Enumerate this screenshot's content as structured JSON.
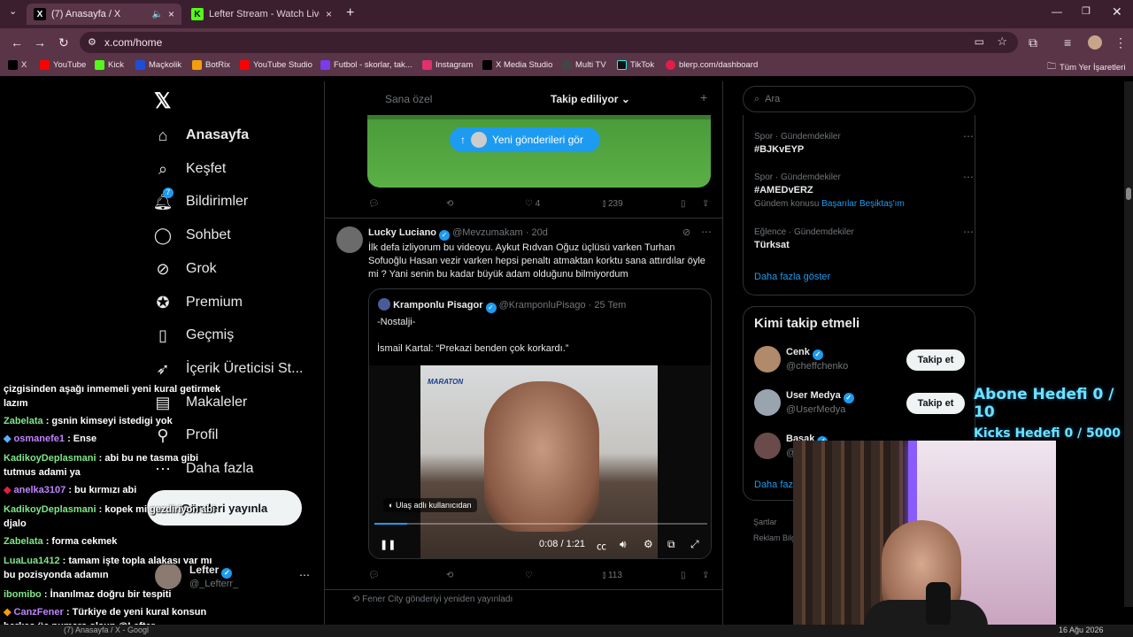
{
  "browser": {
    "tabs": [
      {
        "label": "(7) Anasayfa / X",
        "favicon": "x-icon",
        "active": true
      },
      {
        "label": "Lefter Stream - Watch Live on K",
        "favicon": "kick-icon",
        "active": false
      }
    ],
    "url": "x.com/home",
    "bookmarks": [
      {
        "label": "X",
        "color": "#000000"
      },
      {
        "label": "YouTube",
        "color": "#ff0000"
      },
      {
        "label": "Kick",
        "color": "#53fc18"
      },
      {
        "label": "Maçkolik",
        "color": "#1d4ed8"
      },
      {
        "label": "BotRix",
        "color": "#f59e0b"
      },
      {
        "label": "YouTube Studio",
        "color": "#ff0000"
      },
      {
        "label": "Futbol - skorlar, tak...",
        "color": "#7c3aed"
      },
      {
        "label": "Instagram",
        "color": "#e1306c"
      },
      {
        "label": "X Media Studio",
        "color": "#000000"
      },
      {
        "label": "Multi TV",
        "color": "#444444"
      },
      {
        "label": "TikTok",
        "color": "#111111"
      },
      {
        "label": "blerp.com/dashboard",
        "color": "#e11d48"
      }
    ],
    "all_bookmarks": "Tüm Yer İşaretleri"
  },
  "sidebar": {
    "items": [
      {
        "label": "Anasayfa",
        "icon": "home-icon"
      },
      {
        "label": "Keşfet",
        "icon": "search-icon"
      },
      {
        "label": "Bildirimler",
        "icon": "bell-icon",
        "badge": "7"
      },
      {
        "label": "Sohbet",
        "icon": "chat-icon"
      },
      {
        "label": "Grok",
        "icon": "grok-icon"
      },
      {
        "label": "Premium",
        "icon": "premium-icon"
      },
      {
        "label": "Geçmiş",
        "icon": "bookmark-icon"
      },
      {
        "label": "İçerik Üreticisi St...",
        "icon": "rocket-icon"
      },
      {
        "label": "Makaleler",
        "icon": "article-icon"
      },
      {
        "label": "Profil",
        "icon": "profile-icon"
      },
      {
        "label": "Daha fazla",
        "icon": "more-icon"
      }
    ],
    "post_button": "Gönderi yayınla",
    "account": {
      "name": "Lefter",
      "handle": "@_Leftеrr_"
    }
  },
  "feed": {
    "tabs": [
      "Sana özel",
      "Takip ediliyor"
    ],
    "new_posts_pill": "Yeni gönderileri gör",
    "post1_actions": {
      "likes": "4",
      "views": "239"
    },
    "post2": {
      "name": "Lucky Luciano",
      "handle": "@Mevzumakam",
      "time": "· 20d",
      "text": "İlk defa izliyorum bu videoyu. Aykut Rıdvan Oğuz üçlüsü varken Turhan Sofuoğlu Hasan vezir varken hepsi penaltı atmaktan korktu sana attırdılar öyle mi ? Yani senin bu kadar büyük adam olduğunu bilmiyordum",
      "quote": {
        "name": "Kramponlu Pisagor",
        "handle": "@KramponluPisago",
        "time": "· 25 Tem",
        "line1": "-Nostalji-",
        "line2": "İsmail Kartal: “Prekazi benden çok korkardı.”",
        "video_logo": "MARATON",
        "attribution": "Ulaş adlı kullanıcıdan",
        "timecode": "0:08 / 1:21"
      },
      "actions": {
        "views": "113"
      }
    },
    "repost_note": "Fener City gönderiyi yeniden yayınladı"
  },
  "right": {
    "search_placeholder": "Ara",
    "trends": [
      {
        "category": "Spor · Gündemdekiler",
        "name": "#BJKvEYP",
        "extra": ""
      },
      {
        "category": "Spor · Gündemdekiler",
        "name": "#AMEDvERZ",
        "extra_label": "Gündem konusu",
        "extra_link": "Başarılar Beşiktaş'ım"
      },
      {
        "category": "Eğlence · Gündemdekiler",
        "name": "Türksat",
        "extra": ""
      }
    ],
    "show_more": "Daha fazla göster",
    "who_to_follow_title": "Kimi takip etmeli",
    "who_to_follow": [
      {
        "name": "Cenk",
        "handle": "@cheffchenko",
        "button": "Takip et",
        "color": "#b08a6a"
      },
      {
        "name": "User Medya",
        "handle": "@UserMedya",
        "button": "Takip et",
        "color": "#9aa4ae"
      },
      {
        "name": "Başak",
        "handle": "@",
        "button": "Takip et",
        "color": "#6a4a4a"
      }
    ],
    "who_show_more": "Daha faz",
    "footer": [
      "Şartlar",
      "Reklam Bilg"
    ]
  },
  "stream_overlay": {
    "goal1": "Abone Hedefi 0 / 10",
    "goal2": "Kicks Hedefi 0 / 5000",
    "chat": [
      {
        "user": "",
        "msg": "çizgisinden aşağı inmemeli yeni kural getirmek lazım",
        "color": "#ffffff"
      },
      {
        "user": "Zabelata",
        "msg": ": gsnin kimseyi istedigi yok",
        "color": "#7ee787"
      },
      {
        "user": "osmanefe1",
        "msg": ": Ense",
        "color": "#c084fc"
      },
      {
        "user": "KadikoyDeplasmani",
        "msg": ": abi bu ne tasma gibi tutmus adami ya",
        "color": "#7ee787"
      },
      {
        "user": "anelka3107",
        "msg": ": bu kırmızı abi",
        "color": "#c084fc"
      },
      {
        "user": "KadikoyDeplasmani",
        "msg": ": kopek mi gezdiriyon abi djalo",
        "color": "#7ee787"
      },
      {
        "user": "Zabelata",
        "msg": ": forma cekmek",
        "color": "#7ee787"
      },
      {
        "user": "LuaLua1412",
        "msg": ": tamam işte topla alakası var mı bu pozisyonda adamın",
        "color": "#7ee787"
      },
      {
        "user": "ibomibo",
        "msg": ": İnanılmaz doğru bir tespiti",
        "color": "#7ee787"
      },
      {
        "user": "CanzFener",
        "msg": ": Türkiye de yeni kural konsun herkes üç numara olsun @Lefter",
        "color": "#c084fc"
      }
    ]
  },
  "taskbar": {
    "window_label": "(7) Anasayfa / X - Googl",
    "date": "16 Ağu 2026"
  }
}
